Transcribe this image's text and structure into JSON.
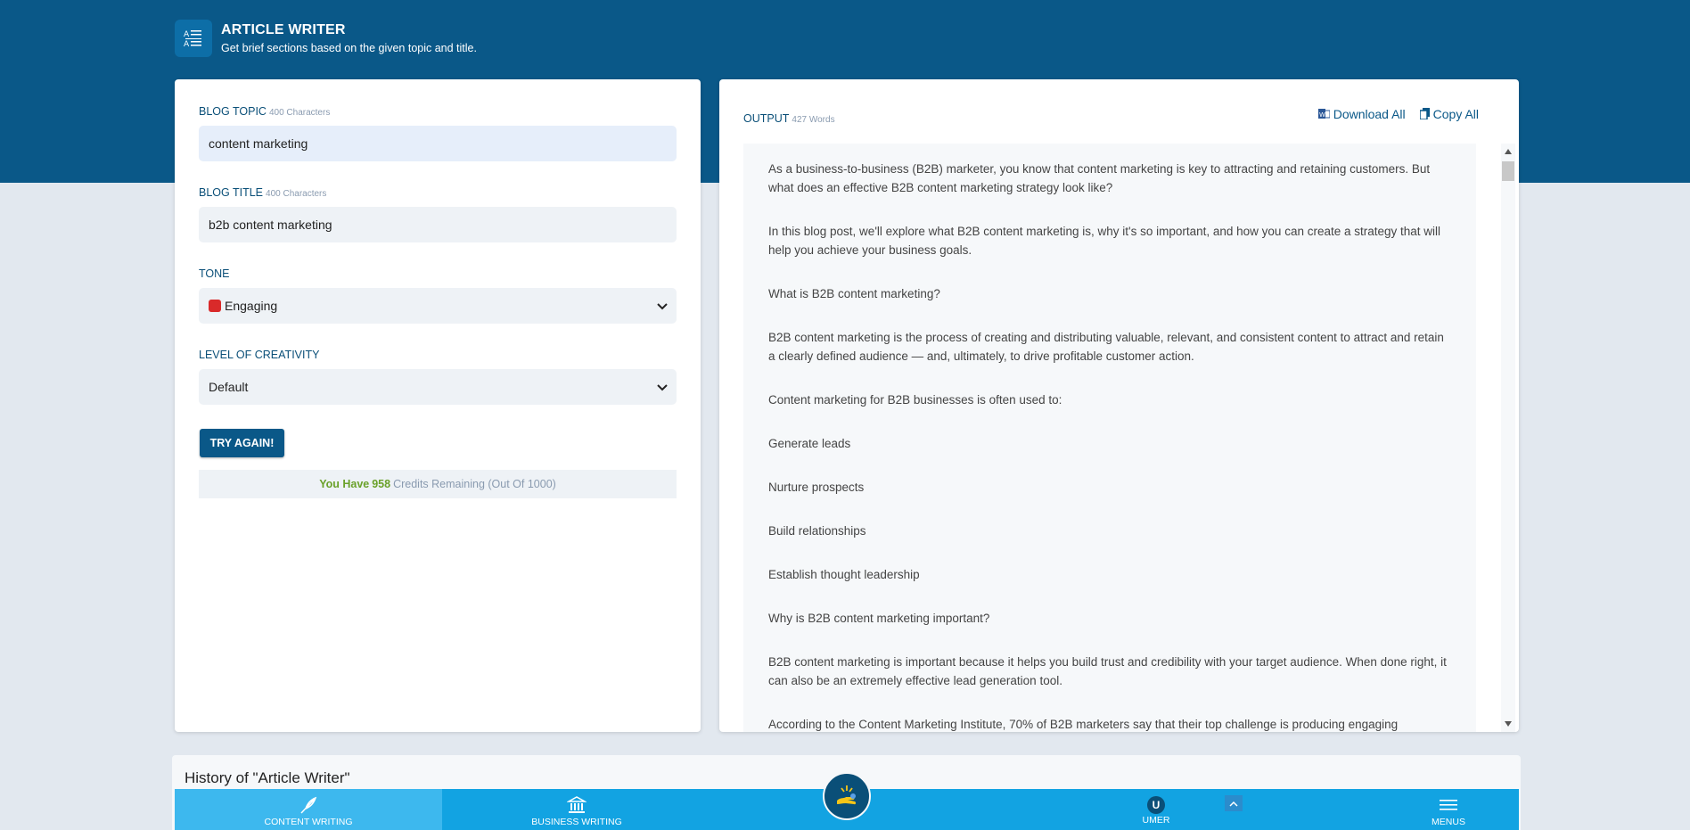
{
  "header": {
    "title": "ARTICLE WRITER",
    "subtitle": "Get brief sections based on the given topic and title."
  },
  "form": {
    "topic_label": "BLOG TOPIC",
    "topic_hint": "400 Characters",
    "topic_value": "content marketing",
    "title_label": "BLOG TITLE",
    "title_hint": "400 Characters",
    "title_value": "b2b content marketing",
    "tone_label": "TONE",
    "tone_value": "Engaging",
    "creativity_label": "LEVEL OF CREATIVITY",
    "creativity_value": "Default",
    "try_again": "TRY AGAIN!",
    "credits_prefix": "You Have",
    "credits_count": "958",
    "credits_suffix": "Credits Remaining (Out Of 1000)"
  },
  "output": {
    "label": "OUTPUT",
    "word_count": "427 Words",
    "download_all": "Download All",
    "copy_all": "Copy All",
    "paragraphs": [
      "As a business-to-business (B2B) marketer, you know that content marketing is key to attracting and retaining customers. But what does an effective B2B content marketing strategy look like?",
      "In this blog post, we'll explore what B2B content marketing is, why it's so important, and how you can create a strategy that will help you achieve your business goals.",
      "What is B2B content marketing?",
      "B2B content marketing is the process of creating and distributing valuable, relevant, and consistent content to attract and retain a clearly defined audience — and, ultimately, to drive profitable customer action.",
      "Content marketing for B2B businesses is often used to:",
      "Generate leads",
      "Nurture prospects",
      "Build relationships",
      "Establish thought leadership",
      "Why is B2B content marketing important?",
      "B2B content marketing is important because it helps you build trust and credibility with your target audience. When done right, it can also be an extremely effective lead generation tool.",
      "According to the Content Marketing Institute, 70% of B2B marketers say that their top challenge is producing engaging"
    ]
  },
  "history": {
    "title": "History of \"Article Writer\""
  },
  "bottom_nav": {
    "content_writing": "CONTENT WRITING",
    "business_writing": "BUSINESS WRITING",
    "user_initial": "U",
    "user_name": "UMER",
    "menus": "MENUS"
  },
  "colors": {
    "brand_dark": "#0a5888",
    "nav_blue": "#12a3e2",
    "credits_green": "#6aa12a"
  }
}
